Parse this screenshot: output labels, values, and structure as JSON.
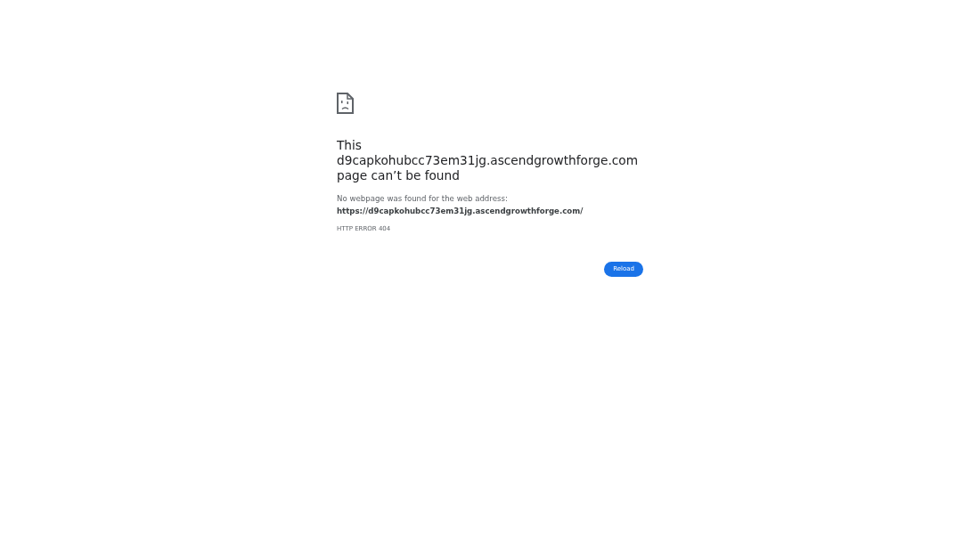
{
  "heading": "This d9capkohubcc73em31jg.ascendgrowthforge.com page can’t be found",
  "description": "No webpage was found for the web address: **https://d9capkohubcc73em31jg.ascendgrowthforge.com/**",
  "error_code": "HTTP ERROR 404",
  "buttons": [
    {
      "label": "Reload"
    }
  ]
}
